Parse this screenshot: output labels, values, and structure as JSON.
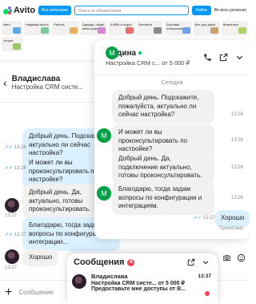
{
  "avito": {
    "logo": "Avito",
    "categories_button": "Все категории",
    "search_placeholder": "Поиск по объявлениям",
    "find_button": "Найти",
    "region": "Во всех регионах",
    "categories": [
      "Авто",
      "Недвижи-мость",
      "Работа",
      "Одежда, обувь, аксессуары",
      "Хобби и отдых",
      "Запчасти",
      "Бытовая электроника",
      "Все для дома",
      "Услуги",
      "Электро-ника",
      "Для дома и дачи",
      "Животные"
    ]
  },
  "back_chat": {
    "title": "Владислава",
    "subtitle": "Настройка CRM систе...",
    "date_label": "Сегодня",
    "messages": [
      {
        "dir": "out",
        "text": "Добрый день. Подскажите, актуально ли сейчас настройка?",
        "time": "13:26"
      },
      {
        "dir": "out",
        "text": "И может ли вы проконсультировать по настройке?",
        "time": "13:26"
      },
      {
        "dir": "in",
        "text": "Добрый день. Да, актуально, готовы проконсультировать.",
        "time": "13:27"
      },
      {
        "dir": "out",
        "text": "Благодарю, тогда задам вопросы по конфигурации и интеграции...",
        "time": "13:27"
      },
      {
        "dir": "in",
        "text": "Хорошо",
        "time": "13:27"
      }
    ],
    "input_placeholder": "Сообщение"
  },
  "front_chat": {
    "name": "Мадина",
    "subtitle": "Настройка CRM с... от 5 000 ₽",
    "date_label": "Сегодня",
    "avatar_letter": "М",
    "messages": [
      {
        "dir": "in",
        "text": "Добрый день. Подскажите, пожалуйста, актуально ли сейчас настройка?",
        "time": "13:26"
      },
      {
        "dir": "in",
        "text": "И может ли вы проконсультировать по настройке?",
        "time": "13:26"
      },
      {
        "dir": "in",
        "text": "Добрый день. Да, подключение актуально, готовы проконсультировать.",
        "time": "13:26"
      },
      {
        "dir": "in",
        "text": "Благодарю, тогда задам вопросы по конфигурации и интеграциям.",
        "time": "13:26"
      },
      {
        "dir": "out",
        "text": "Хорошо",
        "time": "13:27"
      }
    ],
    "read_label": "Прочитано"
  },
  "popup": {
    "title": "Сообщения",
    "badge": "8",
    "item": {
      "name": "Владислава",
      "line1": "Настройка CRM систе... от 5 000 ₽",
      "line2": "Предоставьте мне доступы от В...",
      "time": "13:37"
    }
  }
}
